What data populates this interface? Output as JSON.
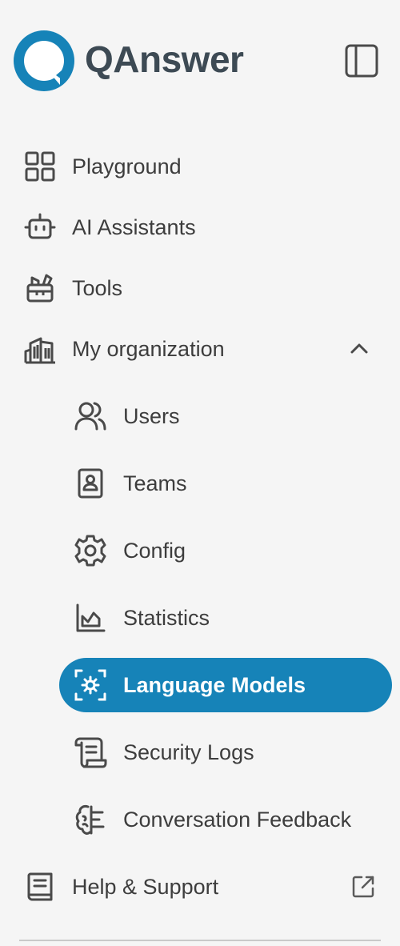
{
  "app": {
    "name": "QAnswer"
  },
  "colors": {
    "accent": "#1683b8",
    "text": "#3d3d3d",
    "logo_text": "#3d4a54"
  },
  "sidebar": {
    "toggle_icon": "sidebar-toggle-icon",
    "items": [
      {
        "label": "Playground",
        "icon": "grid-icon"
      },
      {
        "label": "AI Assistants",
        "icon": "robot-icon"
      },
      {
        "label": "Tools",
        "icon": "toolbox-icon"
      },
      {
        "label": "My organization",
        "icon": "building-icon",
        "expanded": true
      }
    ],
    "org_items": [
      {
        "label": "Users",
        "icon": "users-icon"
      },
      {
        "label": "Teams",
        "icon": "contact-book-icon"
      },
      {
        "label": "Config",
        "icon": "gear-icon"
      },
      {
        "label": "Statistics",
        "icon": "chart-icon"
      },
      {
        "label": "Language Models",
        "icon": "model-settings-icon",
        "active": true
      },
      {
        "label": "Security Logs",
        "icon": "scroll-icon"
      },
      {
        "label": "Conversation Feedback",
        "icon": "brain-icon"
      }
    ],
    "help": {
      "label": "Help & Support",
      "icon": "book-icon",
      "external_icon": "external-link-icon"
    }
  }
}
